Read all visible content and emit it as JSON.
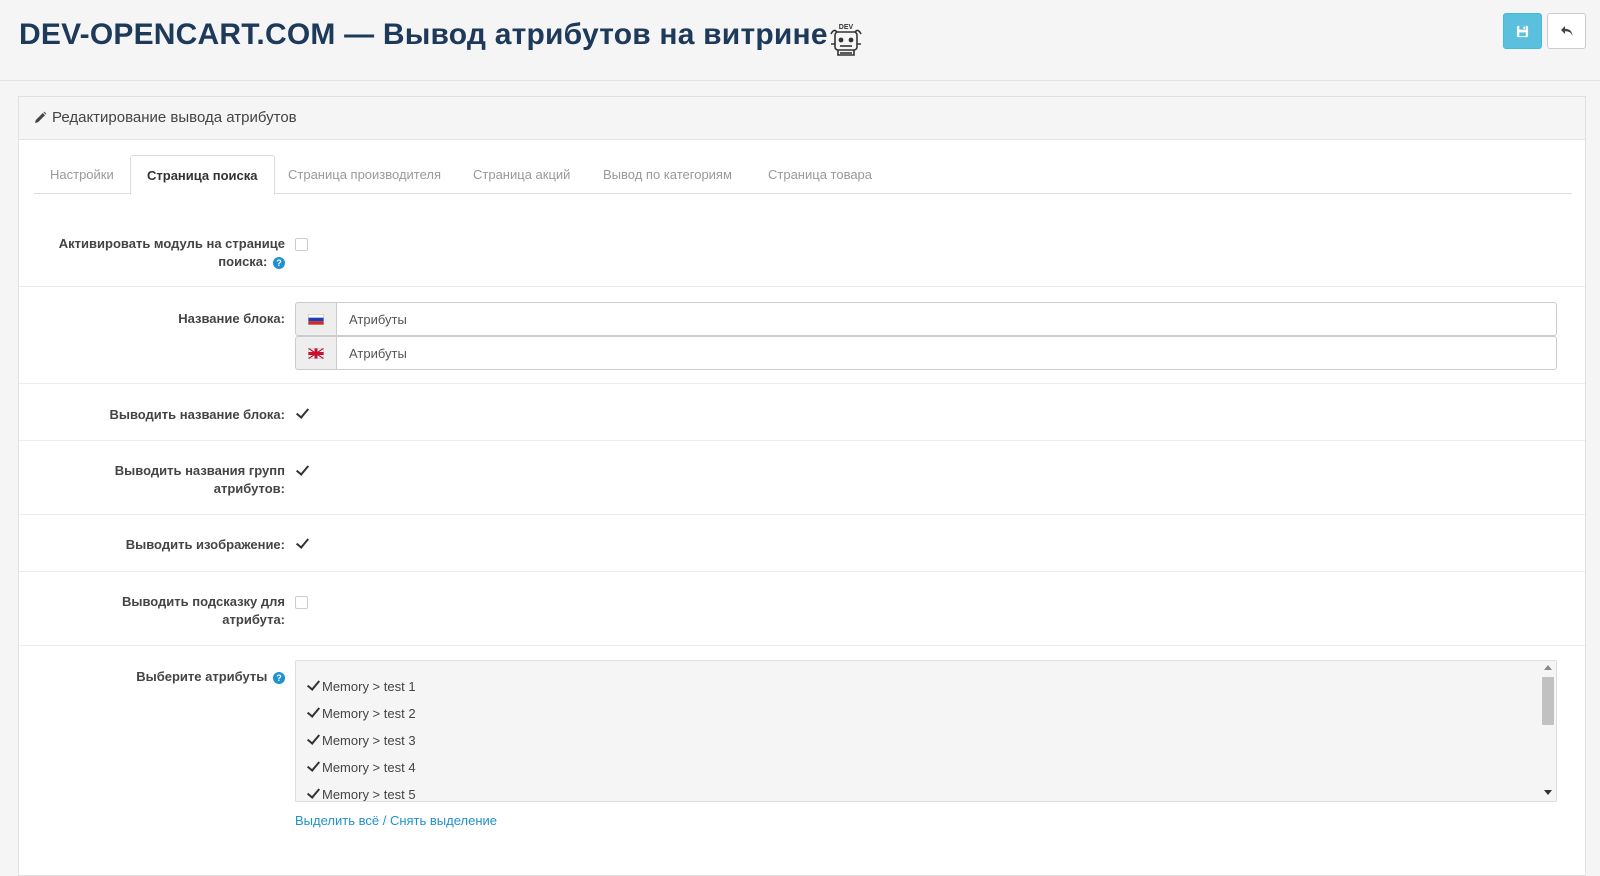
{
  "header": {
    "title_brand": "DEV-OPENCART.COM",
    "title_separator": "—",
    "title_text": "Вывод атрибутов на витрине",
    "logo_icon": "dev-robot-logo-icon",
    "logo_text": "DEV",
    "save_icon": "floppy-disk-icon",
    "back_icon": "reply-arrow-icon"
  },
  "panel": {
    "icon": "pencil-icon",
    "title": "Редактирование вывода атрибутов"
  },
  "tabs": [
    {
      "label": "Настройки",
      "active": false
    },
    {
      "label": "Страница поиска",
      "active": true
    },
    {
      "label": "Страница производителя",
      "active": false
    },
    {
      "label": "Страница акций",
      "active": false
    },
    {
      "label": "Вывод по категориям",
      "active": false
    },
    {
      "label": "Страница товара",
      "active": false
    }
  ],
  "form": {
    "activate": {
      "label": "Активировать модуль на странице поиска:",
      "checked": false,
      "help_icon": "question-circle-icon"
    },
    "block_name": {
      "label": "Название блока:",
      "ru": {
        "flag_icon": "flag-ru-icon",
        "value": "Атрибуты"
      },
      "en": {
        "flag_icon": "flag-gb-icon",
        "value": "Атрибуты"
      }
    },
    "show_block_name": {
      "label": "Выводить название блока:",
      "checked": true
    },
    "show_group_names": {
      "label": "Выводить названия групп атрибутов:",
      "checked": true
    },
    "show_image": {
      "label": "Выводить изображение:",
      "checked": true
    },
    "show_hint": {
      "label": "Выводить подсказку для атрибута:",
      "checked": false
    },
    "attributes": {
      "label": "Выберите атрибуты",
      "help_icon": "question-circle-icon",
      "items": [
        {
          "label": "Memory > test 1",
          "checked": true
        },
        {
          "label": "Memory > test 2",
          "checked": true
        },
        {
          "label": "Memory > test 3",
          "checked": true
        },
        {
          "label": "Memory > test 4",
          "checked": true
        },
        {
          "label": "Memory > test 5",
          "checked": true
        }
      ],
      "select_all": "Выделить всё",
      "separator": "/",
      "deselect": "Снять выделение"
    }
  },
  "colors": {
    "title": "#1e3a5a",
    "accent": "#5bc0de",
    "link": "#1e91cf"
  }
}
